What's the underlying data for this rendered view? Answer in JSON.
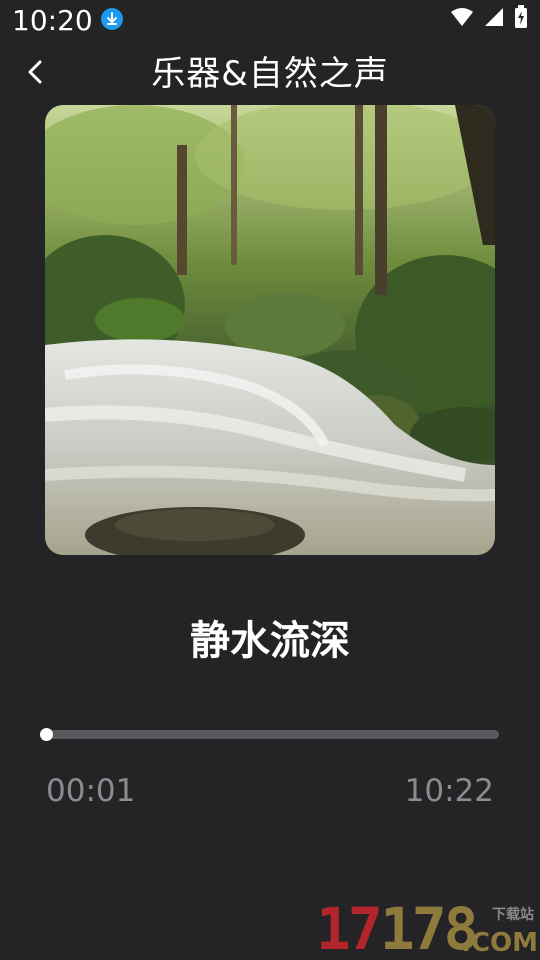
{
  "status_bar": {
    "time": "10:20",
    "icons": [
      "download-icon",
      "wifi-icon",
      "cellular-signal-icon",
      "battery-charging-icon"
    ]
  },
  "header": {
    "title": "乐器&自然之声",
    "back_icon": "chevron-left-icon"
  },
  "player": {
    "cover_image": "forest-stream-cover",
    "track_title": "静水流深",
    "current_time": "00:01",
    "total_time": "10:22",
    "progress": 0.002
  },
  "watermark": {
    "number_a": "17",
    "number_b": "178",
    "sub": "下载站",
    "domain": ".COM"
  },
  "colors": {
    "background": "#242427",
    "accent_download": "#1e9bf0",
    "track": "#5a5a5e",
    "time_text": "#8c8c90"
  }
}
